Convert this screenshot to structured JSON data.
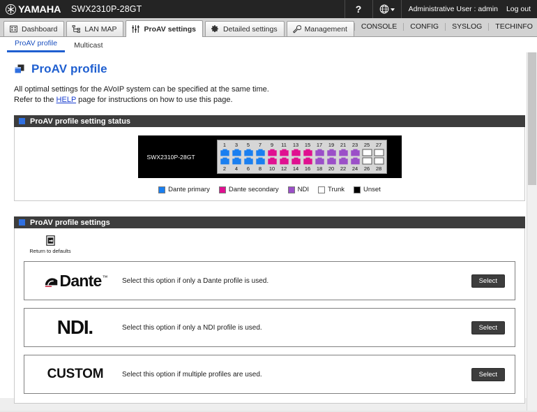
{
  "header": {
    "brand": "YAMAHA",
    "model": "SWX2310P-28GT",
    "help_label": "?",
    "user_label": "Administrative User : admin",
    "logout_label": "Log out"
  },
  "nav": {
    "tabs": [
      {
        "label": "Dashboard",
        "icon": "dashboard-icon",
        "active": false
      },
      {
        "label": "LAN MAP",
        "icon": "lanmap-icon",
        "active": false
      },
      {
        "label": "ProAV settings",
        "icon": "sliders-icon",
        "active": true
      },
      {
        "label": "Detailed settings",
        "icon": "gear-icon",
        "active": false
      },
      {
        "label": "Management",
        "icon": "wrench-icon",
        "active": false
      }
    ],
    "links": [
      "CONSOLE",
      "CONFIG",
      "SYSLOG",
      "TECHINFO"
    ]
  },
  "subtabs": [
    {
      "label": "ProAV profile",
      "active": true
    },
    {
      "label": "Multicast",
      "active": false
    }
  ],
  "page": {
    "title": "ProAV profile",
    "desc_line1": "All optimal settings for the AVoIP system can be specified at the same time.",
    "desc_line2_pre": "Refer to the ",
    "desc_link": "HELP",
    "desc_line2_post": " page for instructions on how to use this page."
  },
  "status_section": {
    "title": "ProAV profile setting status",
    "device_label": "SWX2310P-28GT",
    "ports": [
      {
        "number": 1,
        "state": "dante_primary"
      },
      {
        "number": 2,
        "state": "dante_primary"
      },
      {
        "number": 3,
        "state": "dante_primary"
      },
      {
        "number": 4,
        "state": "dante_primary"
      },
      {
        "number": 5,
        "state": "dante_primary"
      },
      {
        "number": 6,
        "state": "dante_primary"
      },
      {
        "number": 7,
        "state": "dante_primary"
      },
      {
        "number": 8,
        "state": "dante_primary"
      },
      {
        "number": 9,
        "state": "dante_secondary"
      },
      {
        "number": 10,
        "state": "dante_secondary"
      },
      {
        "number": 11,
        "state": "dante_secondary"
      },
      {
        "number": 12,
        "state": "dante_secondary"
      },
      {
        "number": 13,
        "state": "dante_secondary"
      },
      {
        "number": 14,
        "state": "dante_secondary"
      },
      {
        "number": 15,
        "state": "dante_secondary"
      },
      {
        "number": 16,
        "state": "dante_secondary"
      },
      {
        "number": 17,
        "state": "ndi"
      },
      {
        "number": 18,
        "state": "ndi"
      },
      {
        "number": 19,
        "state": "ndi"
      },
      {
        "number": 20,
        "state": "ndi"
      },
      {
        "number": 21,
        "state": "ndi"
      },
      {
        "number": 22,
        "state": "ndi"
      },
      {
        "number": 23,
        "state": "ndi"
      },
      {
        "number": 24,
        "state": "ndi"
      },
      {
        "number": 25,
        "state": "trunk"
      },
      {
        "number": 26,
        "state": "trunk"
      },
      {
        "number": 27,
        "state": "trunk"
      },
      {
        "number": 28,
        "state": "trunk"
      }
    ],
    "legend": [
      {
        "label": "Dante primary",
        "color": "#1a7ff0"
      },
      {
        "label": "Dante secondary",
        "color": "#e01090"
      },
      {
        "label": "NDI",
        "color": "#9b4fc8"
      },
      {
        "label": "Trunk",
        "color": "#ffffff"
      },
      {
        "label": "Unset",
        "color": "#000000"
      }
    ]
  },
  "settings_section": {
    "title": "ProAV profile settings",
    "return_defaults_label": "Return to defaults",
    "cards": [
      {
        "logo": "Dante",
        "logo_type": "dante",
        "tm": "™",
        "desc": "Select this option if only a Dante profile is used.",
        "button": "Select"
      },
      {
        "logo": "NDI",
        "logo_type": "ndi",
        "desc": "Select this option if only a NDI profile is used.",
        "button": "Select"
      },
      {
        "logo": "CUSTOM",
        "logo_type": "custom",
        "desc": "Select this option if multiple profiles are used.",
        "button": "Select"
      }
    ]
  },
  "colors": {
    "dante_primary": "#1a7ff0",
    "dante_secondary": "#e01090",
    "ndi": "#9b4fc8",
    "trunk": "#ffffff",
    "unset": "#000000",
    "accent_blue": "#1f5fd0",
    "section_bar": "#3d3d3d"
  }
}
